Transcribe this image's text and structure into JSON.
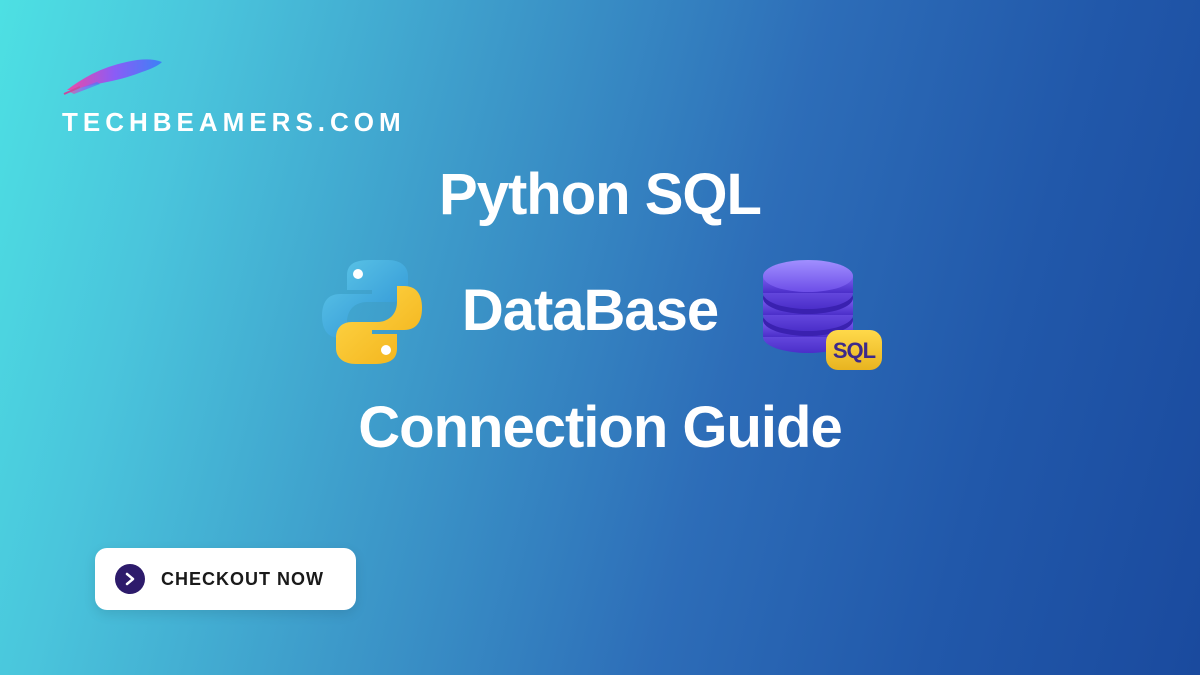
{
  "brand": {
    "name": "TECHBEAMERS.COM"
  },
  "hero": {
    "line1": "Python SQL",
    "line2": "DataBase",
    "line3": "Connection Guide"
  },
  "cta": {
    "label": "CHECKOUT NOW"
  },
  "icons": {
    "python": "python-logo",
    "database": "sql-database",
    "feather": "feather-logo"
  },
  "db_badge": "SQL"
}
